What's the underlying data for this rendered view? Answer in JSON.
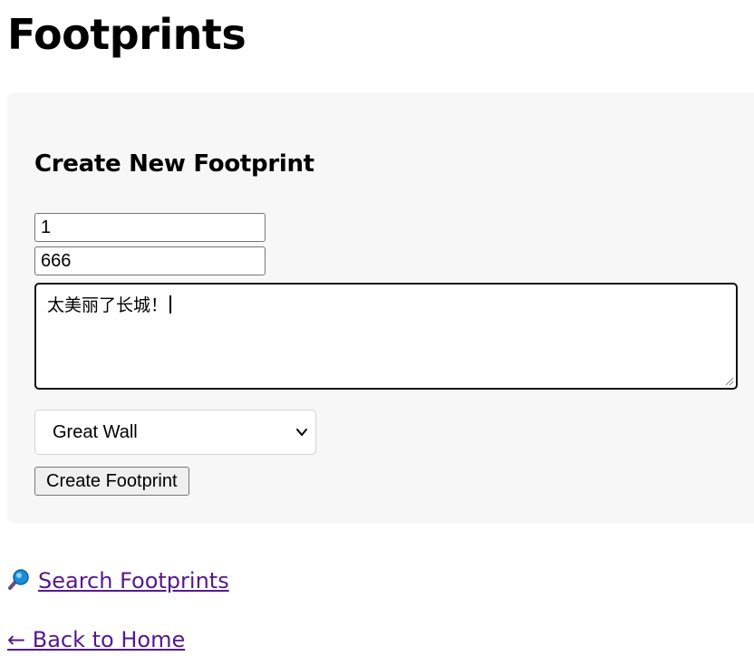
{
  "page": {
    "title": "Footprints"
  },
  "form": {
    "heading": "Create New Footprint",
    "field1_value": "1",
    "field2_value": "666",
    "comment_value": "太美丽了长城！",
    "location_selected": "Great Wall",
    "submit_label": "Create Footprint"
  },
  "links": {
    "search_label": "Search Footprints",
    "search_icon": "magnifying-glass-icon",
    "home_label": "← Back to Home"
  },
  "colors": {
    "panel_background": "#f7f7f7",
    "visited_link": "#551a8b"
  }
}
